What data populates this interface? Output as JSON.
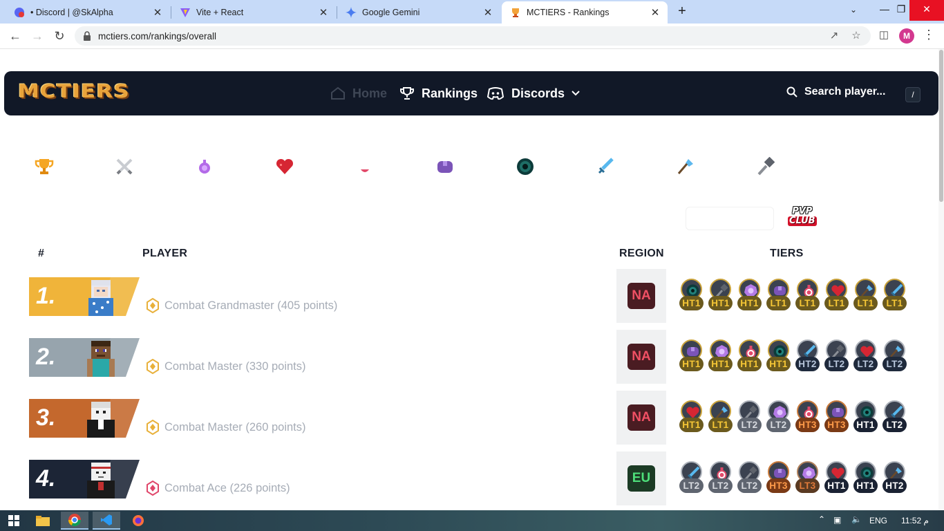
{
  "browser": {
    "tabs": [
      {
        "title": "• Discord | @SkAlpha",
        "icon": "discord-icon"
      },
      {
        "title": "Vite + React",
        "icon": "vite-icon"
      },
      {
        "title": "Google Gemini",
        "icon": "gemini-icon"
      },
      {
        "title": "MCTIERS - Rankings",
        "icon": "mctiers-icon",
        "active": true
      }
    ],
    "url": "mctiers.com/rankings/overall",
    "profile_initial": "M"
  },
  "site": {
    "logo": "MCTIERS",
    "nav": {
      "home": "Home",
      "rankings": "Rankings",
      "discords": "Discords"
    },
    "search_placeholder": "Search player...",
    "search_shortcut": "/"
  },
  "categories": [
    "overall-trophy-icon",
    "combat-swords-icon",
    "potion-purple-icon",
    "heart-icon",
    "potion-pink-icon",
    "armor-purple-icon",
    "ender-pearl-icon",
    "diamond-sword-icon",
    "axe-icon",
    "mace-icon"
  ],
  "pvp_logo": {
    "line1": "PVP",
    "line2": "CLUB"
  },
  "table": {
    "headers": {
      "rank": "#",
      "player": "PLAYER",
      "region": "REGION",
      "tiers": "TIERS"
    },
    "rows": [
      {
        "rank": "1.",
        "title": "Combat Grandmaster (405 points)",
        "region": "NA",
        "tiers": [
          {
            "icon": "pearl",
            "label": "HT1",
            "style": "gold"
          },
          {
            "icon": "mace",
            "label": "HT1",
            "style": "gold"
          },
          {
            "icon": "orb",
            "label": "HT1",
            "style": "gold"
          },
          {
            "icon": "armor",
            "label": "LT1",
            "style": "gold"
          },
          {
            "icon": "potion",
            "label": "LT1",
            "style": "gold"
          },
          {
            "icon": "heart",
            "label": "LT1",
            "style": "gold"
          },
          {
            "icon": "axe",
            "label": "LT1",
            "style": "gold"
          },
          {
            "icon": "sword",
            "label": "LT1",
            "style": "gold"
          }
        ]
      },
      {
        "rank": "2.",
        "title": "Combat Master (330 points)",
        "region": "NA",
        "tiers": [
          {
            "icon": "armor",
            "label": "HT1",
            "style": "gold"
          },
          {
            "icon": "orb",
            "label": "HT1",
            "style": "gold"
          },
          {
            "icon": "potion",
            "label": "HT1",
            "style": "gold"
          },
          {
            "icon": "pearl",
            "label": "HT1",
            "style": "gold"
          },
          {
            "icon": "sword",
            "label": "HT2",
            "style": "slate"
          },
          {
            "icon": "mace",
            "label": "LT2",
            "style": "slate"
          },
          {
            "icon": "heart",
            "label": "LT2",
            "style": "slate"
          },
          {
            "icon": "axe",
            "label": "LT2",
            "style": "slate"
          }
        ]
      },
      {
        "rank": "3.",
        "title": "Combat Master (260 points)",
        "region": "NA",
        "tiers": [
          {
            "icon": "heart",
            "label": "HT1",
            "style": "gold"
          },
          {
            "icon": "axe",
            "label": "LT1",
            "style": "gold"
          },
          {
            "icon": "mace",
            "label": "LT2",
            "style": "gray"
          },
          {
            "icon": "orb",
            "label": "LT2",
            "style": "gray"
          },
          {
            "icon": "potion",
            "label": "HT3",
            "style": "orange"
          },
          {
            "icon": "armor",
            "label": "HT3",
            "style": "orange"
          },
          {
            "icon": "pearl",
            "label": "HT1",
            "style": "dark"
          },
          {
            "icon": "sword",
            "label": "LT2",
            "style": "dark"
          }
        ]
      },
      {
        "rank": "4.",
        "title": "Combat Ace (226 points)",
        "region": "EU",
        "tiers": [
          {
            "icon": "sword",
            "label": "LT2",
            "style": "gray"
          },
          {
            "icon": "potion",
            "label": "LT2",
            "style": "gray"
          },
          {
            "icon": "mace",
            "label": "LT2",
            "style": "gray"
          },
          {
            "icon": "armor",
            "label": "HT3",
            "style": "orange"
          },
          {
            "icon": "orb",
            "label": "LT3",
            "style": "brown"
          },
          {
            "icon": "heart",
            "label": "HT1",
            "style": "dark"
          },
          {
            "icon": "pearl",
            "label": "HT1",
            "style": "dark"
          },
          {
            "icon": "axe",
            "label": "HT2",
            "style": "dark"
          }
        ]
      }
    ]
  },
  "colors": {
    "nav_bg": "#111827",
    "rank_1": "#f0b43a",
    "rank_2": "#97a4ad",
    "rank_3": "#c4682d",
    "rank_4": "#1c2536",
    "region_na_bg": "#4a1c22",
    "region_na_text": "#f05064",
    "region_eu_bg": "#1c3b25",
    "region_eu_text": "#4ee07a"
  },
  "taskbar": {
    "language": "ENG",
    "time": "11:52 م"
  }
}
